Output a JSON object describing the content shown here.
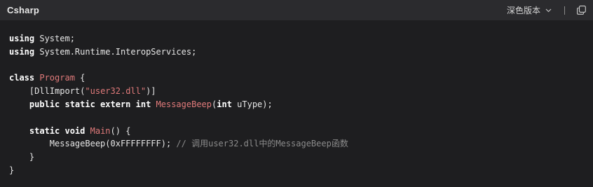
{
  "header": {
    "language": "Csharp",
    "theme_label": "深色版本"
  },
  "icons": {
    "theme_chevron": "chevron-down-icon",
    "copy": "copy-icon"
  },
  "colors": {
    "background": "#1e1e20",
    "header_background": "#2b2b2e",
    "keyword": "#ffffff",
    "identifier_highlight": "#e07a7a",
    "comment": "#8b8b8b"
  },
  "code": {
    "l1": {
      "kw": "using",
      "rest": " System;"
    },
    "l2": {
      "kw": "using",
      "rest": " System.Runtime.InteropServices;"
    },
    "l4": {
      "kw": "class",
      "name": "Program",
      "rest": " {"
    },
    "l5": {
      "indent": "    ",
      "a": "[DllImport(",
      "str": "\"user32.dll\"",
      "b": ")]"
    },
    "l6": {
      "indent": "    ",
      "kw": "public static extern int",
      "name": "MessageBeep",
      "a": "(",
      "kw2": "int",
      "b": " uType);"
    },
    "l8": {
      "indent": "    ",
      "kw": "static void",
      "name": "Main",
      "b": "() {"
    },
    "l9": {
      "indent": "        ",
      "a": "MessageBeep(0xFFFFFFFF); ",
      "comment": "// 调用user32.dll中的MessageBeep函数"
    },
    "l10": {
      "text": "    }"
    },
    "l11": {
      "text": "}"
    }
  }
}
